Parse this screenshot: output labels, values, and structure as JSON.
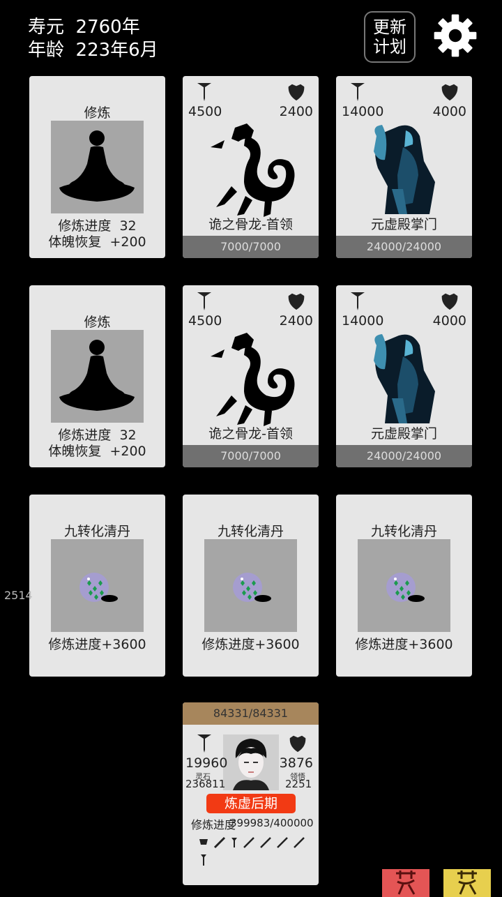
{
  "status": {
    "lifespan_label": "寿元",
    "lifespan_value": "2760年",
    "age_label": "年龄",
    "age_value": "223年6月"
  },
  "header": {
    "plan_button_line1": "更新",
    "plan_button_line2": "计划",
    "settings_icon": "gear-icon"
  },
  "grid": {
    "row1": {
      "cultivate": {
        "title": "修炼",
        "progress_label": "修炼进度",
        "progress_value": "32",
        "recover_label": "体魄恢复",
        "recover_value": "+200"
      },
      "enemy1": {
        "attack": "4500",
        "defense": "2400",
        "name": "诡之骨龙-首领",
        "hp": "7000/7000"
      },
      "enemy2": {
        "attack": "14000",
        "defense": "4000",
        "name": "元虚殿掌门",
        "hp": "24000/24000"
      }
    },
    "row2": {
      "cultivate": {
        "title": "修炼",
        "progress_label": "修炼进度",
        "progress_value": "32",
        "recover_label": "体魄恢复",
        "recover_value": "+200"
      },
      "enemy1": {
        "attack": "4500",
        "defense": "2400",
        "name": "诡之骨龙-首领",
        "hp": "7000/7000"
      },
      "enemy2": {
        "attack": "14000",
        "defense": "4000",
        "name": "元虚殿掌门",
        "hp": "24000/24000"
      }
    },
    "row3": {
      "items": [
        {
          "name": "九转化清丹",
          "effect": "修炼进度+3600"
        },
        {
          "name": "九转化清丹",
          "effect": "修炼进度+3600"
        },
        {
          "name": "九转化清丹",
          "effect": "修炼进度+3600"
        }
      ]
    }
  },
  "side_number": "2514",
  "player": {
    "hp": "84331/84331",
    "attack": "19960",
    "defense": "3876",
    "spirit_stone_label": "灵石",
    "spirit_stone_value": "236811",
    "insight_label": "领悟",
    "insight_value": "2251",
    "realm": "炼虚后期",
    "progress_label": "修炼进度",
    "progress_value": "399983/400000"
  },
  "colors": {
    "background": "#000000",
    "card": "#e6e6e6",
    "hp_bar": "#707070",
    "player_hp_bar": "#a7865c",
    "realm_badge": "#f23a14",
    "stamp_red": "#e45555",
    "stamp_yellow": "#e7cf4e"
  }
}
